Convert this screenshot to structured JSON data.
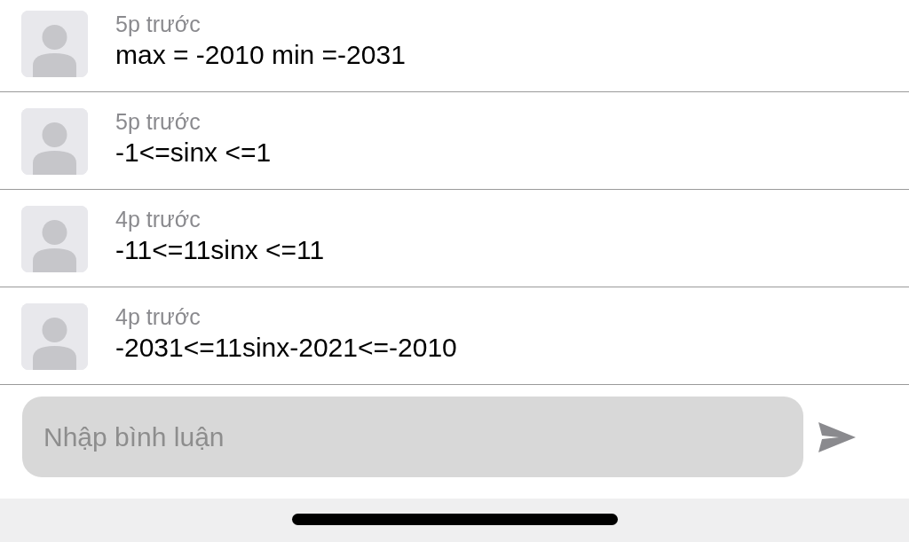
{
  "comments": [
    {
      "time": "5p trước",
      "text": "max = -2010 min =-2031"
    },
    {
      "time": "5p trước",
      "text": "-1<=sinx <=1"
    },
    {
      "time": "4p trước",
      "text": "-11<=11sinx <=11"
    },
    {
      "time": "4p trước",
      "text": "-2031<=11sinx-2021<=-2010"
    }
  ],
  "comment_input": {
    "placeholder": "Nhập bình luận"
  }
}
